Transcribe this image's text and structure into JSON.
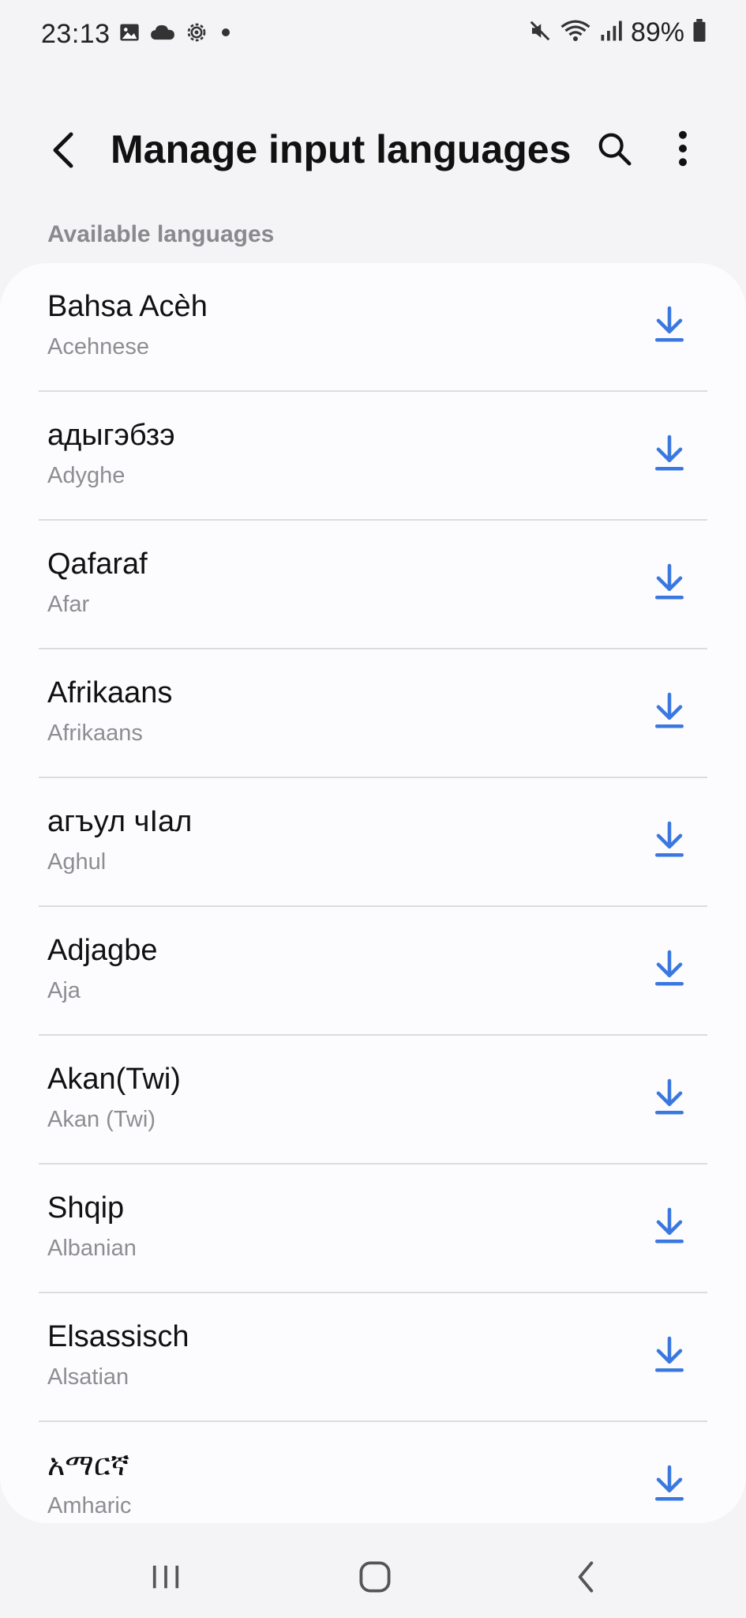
{
  "status_bar": {
    "time": "23:13",
    "battery": "89%",
    "left_icons": [
      "gallery-icon",
      "cloud-icon",
      "settings-gear-icon",
      "notification-dot-icon"
    ],
    "right_icons": [
      "mute-icon",
      "wifi-icon",
      "signal-icon",
      "battery-icon"
    ]
  },
  "header": {
    "title": "Manage input languages",
    "back_icon": "back-chevron-icon",
    "search_icon": "search-icon",
    "more_icon": "more-vertical-icon"
  },
  "section": {
    "label": "Available languages"
  },
  "languages": [
    {
      "name": "Bahsa Acèh",
      "english": "Acehnese"
    },
    {
      "name": "адыгэбзэ",
      "english": "Adyghe"
    },
    {
      "name": "Qafaraf",
      "english": "Afar"
    },
    {
      "name": "Afrikaans",
      "english": "Afrikaans"
    },
    {
      "name": "агъул чӀал",
      "english": "Aghul"
    },
    {
      "name": "Adjagbe",
      "english": "Aja"
    },
    {
      "name": "Akan(Twi)",
      "english": "Akan (Twi)"
    },
    {
      "name": "Shqip",
      "english": "Albanian"
    },
    {
      "name": "Elsassisch",
      "english": "Alsatian"
    },
    {
      "name": "አማርኛ",
      "english": "Amharic"
    }
  ],
  "colors": {
    "accent": "#3a78e0",
    "background": "#f4f4f6",
    "card": "#fcfcfe",
    "secondary_text": "#8e8e92"
  },
  "nav_bar": {
    "icons": [
      "recents-icon",
      "home-icon",
      "back-icon"
    ]
  }
}
